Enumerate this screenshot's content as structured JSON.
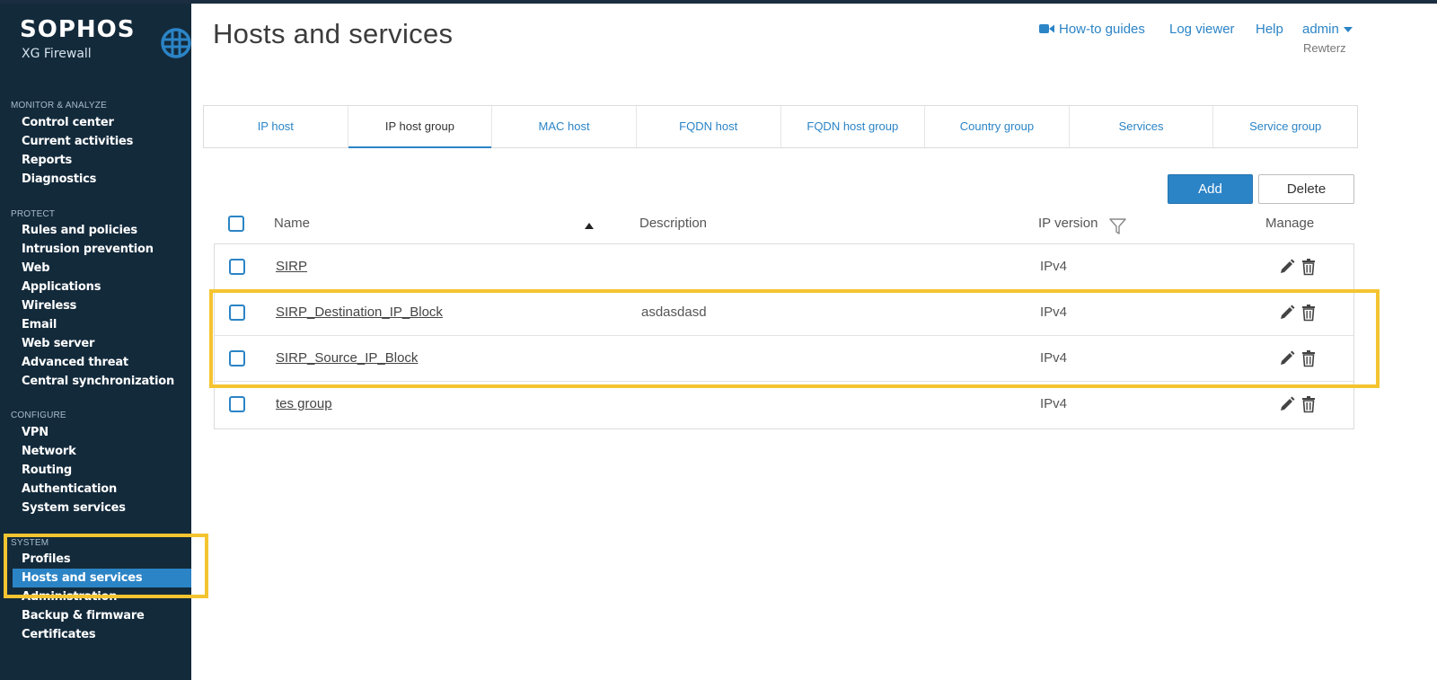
{
  "brand": {
    "name": "SOPHOS",
    "product": "XG Firewall"
  },
  "sidebar": {
    "sections": [
      {
        "label": "MONITOR & ANALYZE",
        "items": [
          "Control center",
          "Current activities",
          "Reports",
          "Diagnostics"
        ]
      },
      {
        "label": "PROTECT",
        "items": [
          "Rules and policies",
          "Intrusion prevention",
          "Web",
          "Applications",
          "Wireless",
          "Email",
          "Web server",
          "Advanced threat",
          "Central synchronization"
        ]
      },
      {
        "label": "CONFIGURE",
        "items": [
          "VPN",
          "Network",
          "Routing",
          "Authentication",
          "System services"
        ]
      },
      {
        "label": "SYSTEM",
        "items": [
          "Profiles",
          "Hosts and services",
          "Administration",
          "Backup & firmware",
          "Certificates"
        ]
      }
    ],
    "active_item": "Hosts and services"
  },
  "header": {
    "title": "Hosts and services",
    "links": {
      "howto": "How-to guides",
      "logviewer": "Log viewer",
      "help": "Help",
      "user": "admin"
    },
    "user_sub": "Rewterz"
  },
  "tabs": [
    "IP host",
    "IP host group",
    "MAC host",
    "FQDN host",
    "FQDN host group",
    "Country group",
    "Services",
    "Service group"
  ],
  "active_tab": "IP host group",
  "buttons": {
    "add": "Add",
    "delete": "Delete"
  },
  "table": {
    "columns": {
      "name": "Name",
      "description": "Description",
      "ip_version": "IP version",
      "manage": "Manage"
    },
    "rows": [
      {
        "name": "SIRP",
        "description": "",
        "ip_version": "IPv4"
      },
      {
        "name": "SIRP_Destination_IP_Block",
        "description": "asdasdasd",
        "ip_version": "IPv4"
      },
      {
        "name": "SIRP_Source_IP_Block",
        "description": "",
        "ip_version": "IPv4"
      },
      {
        "name": "tes group",
        "description": "",
        "ip_version": "IPv4"
      }
    ]
  },
  "colors": {
    "accent": "#2b84c6",
    "sidebar_bg": "#132a3b",
    "highlight": "#f4c430"
  }
}
